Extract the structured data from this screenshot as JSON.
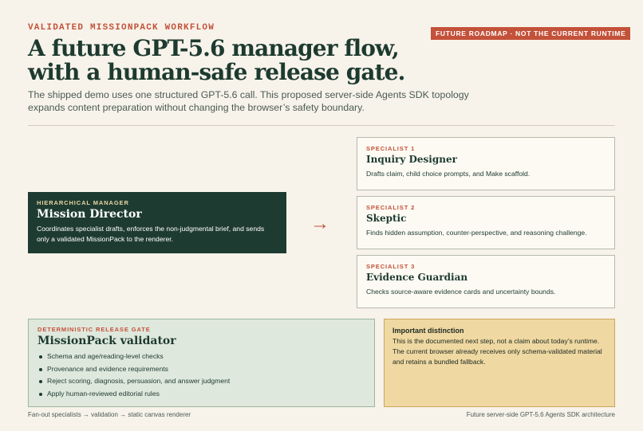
{
  "header": {
    "eyebrow": "VALIDATED MISSIONPACK WORKFLOW",
    "badge": "FUTURE ROADMAP · NOT THE CURRENT RUNTIME",
    "title": "A future GPT-5.6 manager flow, with a human-safe release gate.",
    "subtitle": "The shipped demo uses one structured GPT-5.6 call. This proposed server-side Agents SDK topology expands content preparation without changing the browser’s safety boundary."
  },
  "manager": {
    "kicker": "HIERARCHICAL MANAGER",
    "title": "Mission Director",
    "text": "Coordinates specialist drafts, enforces the non-judgmental brief, and sends only a validated MissionPack to the renderer."
  },
  "arrow": "→",
  "specialists": [
    {
      "kicker": "SPECIALIST 1",
      "title": "Inquiry Designer",
      "text": "Drafts claim, child choice prompts, and Make scaffold."
    },
    {
      "kicker": "SPECIALIST 2",
      "title": "Skeptic",
      "text": "Finds hidden assumption, counter-perspective, and reasoning challenge."
    },
    {
      "kicker": "SPECIALIST 3",
      "title": "Evidence Guardian",
      "text": "Checks source-aware evidence cards and uncertainty bounds."
    }
  ],
  "validator": {
    "kicker": "DETERMINISTIC RELEASE GATE",
    "title": "MissionPack validator",
    "checks": [
      "Schema and age/reading-level checks",
      "Provenance and evidence requirements",
      "Reject scoring, diagnosis, persuasion, and answer judgment",
      "Apply human-reviewed editorial rules"
    ]
  },
  "distinction": {
    "heading": "Important distinction",
    "text": "This is the documented next step, not a claim about today’s runtime. The current browser already receives only schema-validated material and retains a bundled fallback."
  },
  "footer": {
    "left": "Fan-out specialists → validation → static canvas renderer",
    "right": "Future server-side GPT-5.6 Agents SDK architecture"
  },
  "colors": {
    "accent": "#c4513a",
    "manager_bg": "#1e3b31",
    "validator_bg": "#dfe8dc",
    "note_bg": "#efd8a2",
    "page_bg": "#f7f3ea"
  }
}
